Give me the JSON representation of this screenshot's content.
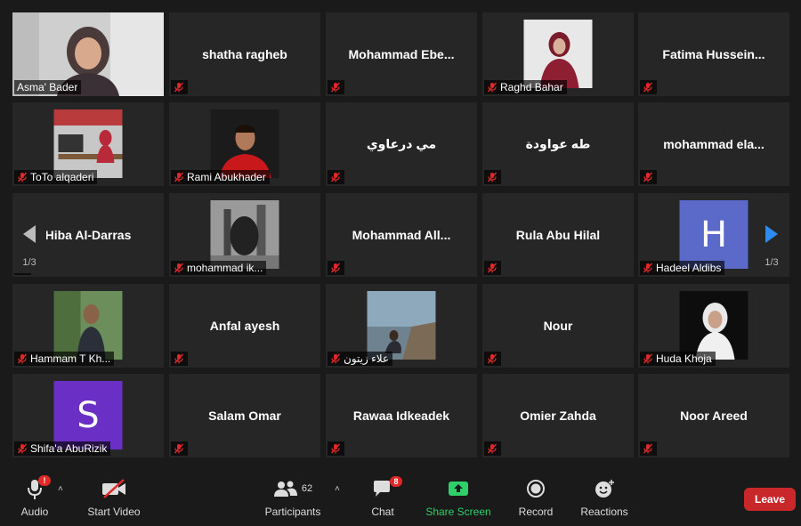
{
  "tiles": [
    {
      "name": "Asma' Bader",
      "type": "video"
    },
    {
      "name": "shatha ragheb",
      "type": "name"
    },
    {
      "name": "Mohammad  Ebe...",
      "type": "name"
    },
    {
      "name": "Raghd Bahar",
      "type": "video"
    },
    {
      "name": "Fatima  Hussein...",
      "type": "name"
    },
    {
      "name": "ToTo alqaderi",
      "type": "video"
    },
    {
      "name": "Rami Abukhader",
      "type": "video"
    },
    {
      "name": "مي درعاوي",
      "type": "name"
    },
    {
      "name": "طه عواودة",
      "type": "name"
    },
    {
      "name": "mohammad  ela...",
      "type": "name"
    },
    {
      "name": "Hiba Al-Darras",
      "type": "name"
    },
    {
      "name": "mohammad ik...",
      "type": "video"
    },
    {
      "name": "Mohammad  All...",
      "type": "name"
    },
    {
      "name": "Rula Abu Hilal",
      "type": "name"
    },
    {
      "name": "Hadeel Aldibs",
      "type": "avatar",
      "letter": "H",
      "color": "#5b6ac8"
    },
    {
      "name": "Hammam T Kh...",
      "type": "video"
    },
    {
      "name": "Anfal ayesh",
      "type": "name"
    },
    {
      "name": "علاء زيتون",
      "type": "video"
    },
    {
      "name": "Nour",
      "type": "name"
    },
    {
      "name": "Huda Khoja",
      "type": "video"
    },
    {
      "name": "Shifa'a AbuRizik",
      "type": "avatar",
      "letter": "S",
      "color": "#6a2fc4"
    },
    {
      "name": "Salam Omar",
      "type": "name"
    },
    {
      "name": "Rawaa Idkeadek",
      "type": "name"
    },
    {
      "name": "Omier Zahda",
      "type": "name"
    },
    {
      "name": "Noor Areed",
      "type": "name"
    }
  ],
  "pagination": {
    "left": "1/3",
    "right": "1/3"
  },
  "toolbar": {
    "audio": "Audio",
    "audio_badge": "!",
    "start_video": "Start Video",
    "participants": "Participants",
    "participants_count": "62",
    "chat": "Chat",
    "chat_badge": "8",
    "share_screen": "Share Screen",
    "record": "Record",
    "reactions": "Reactions",
    "leave": "Leave"
  },
  "colors": {
    "active_speaker": "#c8e35a",
    "share": "#2fd06a",
    "leave": "#c9282b",
    "tile": "#262626"
  }
}
